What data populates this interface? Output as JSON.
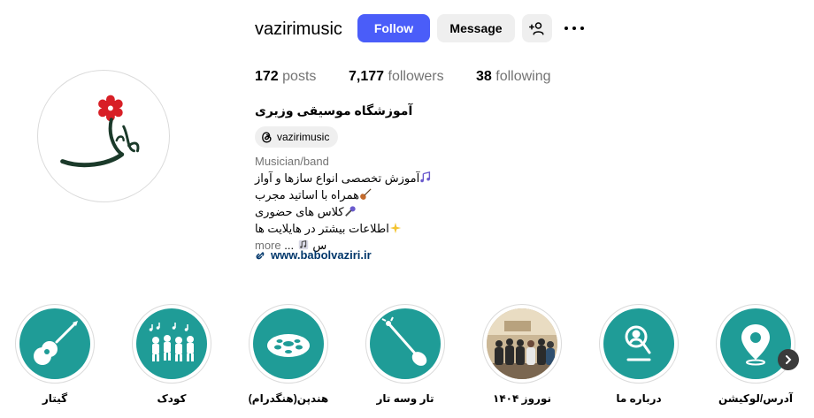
{
  "profile": {
    "username": "vazirimusic",
    "full_name": "آموزشگاه موسیقی وزیری",
    "threads_handle": "vazirimusic",
    "category": "Musician/band",
    "website": "www.babolvaziri.ir"
  },
  "actions": {
    "follow_label": "Follow",
    "message_label": "Message"
  },
  "stats": {
    "posts_count": "172",
    "posts_label": "posts",
    "followers_count": "7,177",
    "followers_label": "followers",
    "following_count": "38",
    "following_label": "following"
  },
  "bio": {
    "lines": [
      "آموزش تخصصی انواع سازها و آواز",
      "همراه با اساتید مجرب",
      "کلاس های حضوری",
      "اطلاعات بیشتر در هایلایت ها",
      "س"
    ],
    "ellipsis": "...",
    "more_label": "more"
  },
  "highlights": [
    {
      "label": "آدرس/لوکیشن",
      "icon": "location-pin-icon"
    },
    {
      "label": "درباره ما",
      "icon": "search-person-icon"
    },
    {
      "label": "نوروز ۱۴۰۴",
      "icon": "group-photo"
    },
    {
      "label": "تار وسه تار",
      "icon": "tar-instrument-icon"
    },
    {
      "label": "هندپن(هنگدرام)",
      "icon": "handpan-icon"
    },
    {
      "label": "کودک",
      "icon": "kids-music-icon"
    },
    {
      "label": "گیتار",
      "icon": "guitar-icon"
    }
  ],
  "colors": {
    "follow_button": "#4a5df9",
    "highlight_teal": "#1f9c97",
    "link_blue": "#00376b",
    "logo_red": "#d81f26",
    "logo_dark": "#1b3a2a"
  }
}
